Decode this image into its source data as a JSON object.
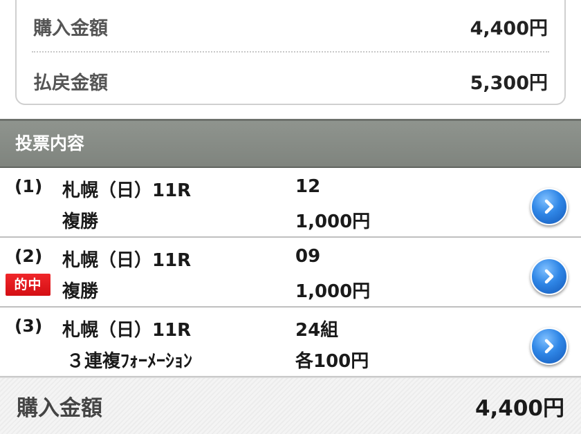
{
  "summary": {
    "purchase_label": "購入金額",
    "purchase_value": "4,400円",
    "payout_label": "払戻金額",
    "payout_value": "5,300円"
  },
  "section": {
    "title": "投票内容"
  },
  "bets": [
    {
      "index": "(1)",
      "race": "札幌（日）11R",
      "type": "複勝",
      "selection": "12",
      "amount": "1,000円",
      "hit": false
    },
    {
      "index": "(2)",
      "badge": "的中",
      "race": "札幌（日）11R",
      "type": "複勝",
      "selection": "09",
      "amount": "1,000円",
      "hit": true
    },
    {
      "index": "(3)",
      "race": "札幌（日）11R",
      "type": "３連複ﾌｫｰﾒｰｼｮﾝ",
      "selection": "24組",
      "amount": "各100円",
      "hit": false
    }
  ],
  "footer": {
    "total_label": "購入金額",
    "total_value": "4,400円"
  },
  "icons": {
    "detail_button": "chevron-right-icon"
  },
  "colors": {
    "header_bg": "#868b85",
    "hit_badge": "#e0161b",
    "detail_button": "#2f86e6"
  }
}
